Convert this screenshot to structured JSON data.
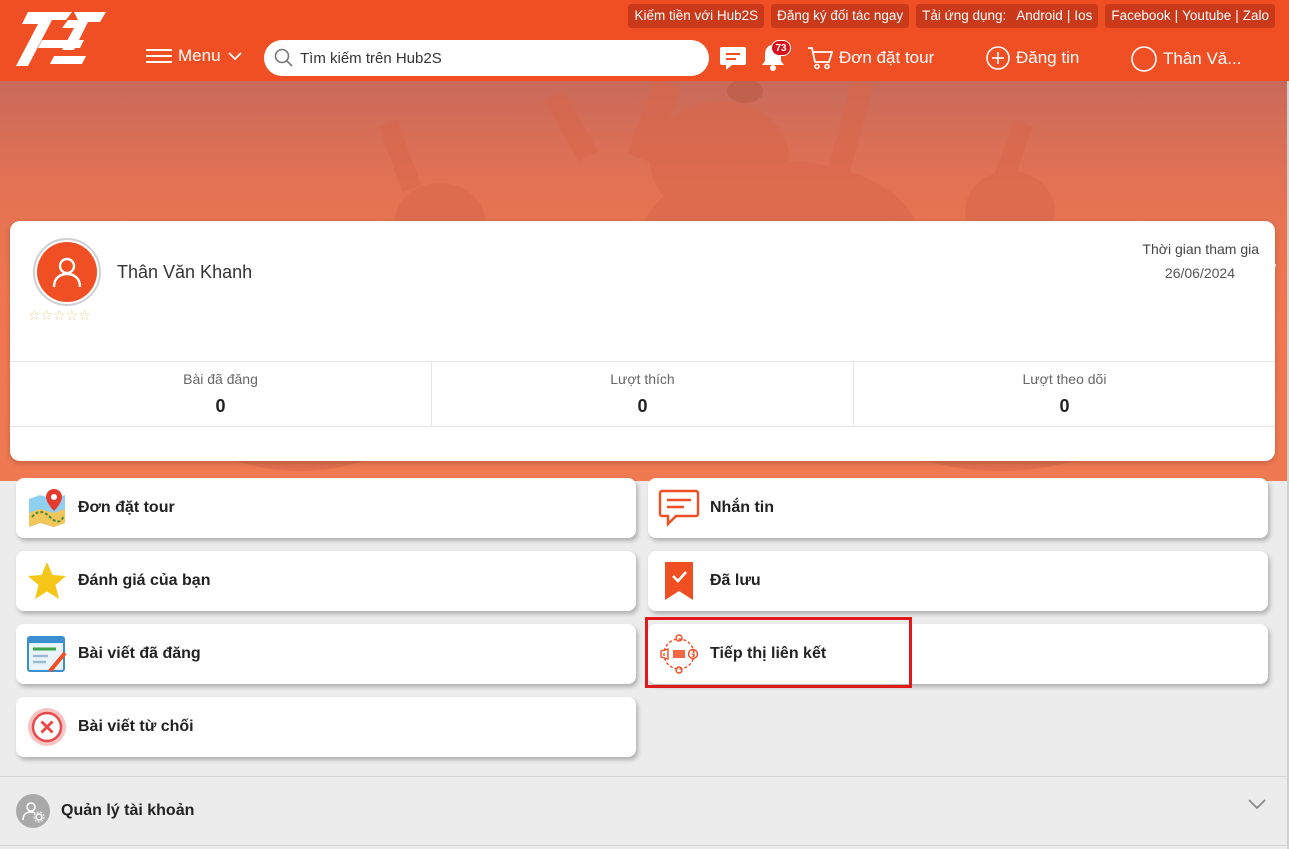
{
  "header": {
    "toplinks": {
      "earn": "Kiếm tiền với Hub2S",
      "partner": "Đăng ký đối tác ngay",
      "app_label": "Tải ứng dụng:",
      "android": "Android",
      "ios": "Ios",
      "facebook": "Facebook",
      "youtube": "Youtube",
      "zalo": "Zalo",
      "sep": "|"
    },
    "menu_label": "Menu",
    "search_placeholder": "Tìm kiếm trên Hub2S",
    "notification_count": "73",
    "tour_order_label": "Đơn đặt tour",
    "post_label": "Đăng tin",
    "user_short": "Thân Vă..."
  },
  "profile": {
    "name": "Thân Văn Khanh",
    "rating_stars": "☆☆☆☆☆",
    "join_label": "Thời gian tham gia",
    "join_date": "26/06/2024",
    "stats": [
      {
        "label": "Bài đã đăng",
        "value": "0"
      },
      {
        "label": "Lượt thích",
        "value": "0"
      },
      {
        "label": "Lượt theo dõi",
        "value": "0"
      }
    ]
  },
  "tiles": {
    "tour_orders": "Đơn đặt tour",
    "messages": "Nhắn tin",
    "reviews": "Đánh giá của bạn",
    "saved": "Đã lưu",
    "posts": "Bài viết đã đăng",
    "affiliate": "Tiếp thị liên kết",
    "rejected": "Bài viết từ chối"
  },
  "account": {
    "label": "Quản lý tài khoản"
  },
  "colors": {
    "brand": "#f04e23",
    "toplink_bg": "#c9391a",
    "highlight": "#e01a1a"
  }
}
